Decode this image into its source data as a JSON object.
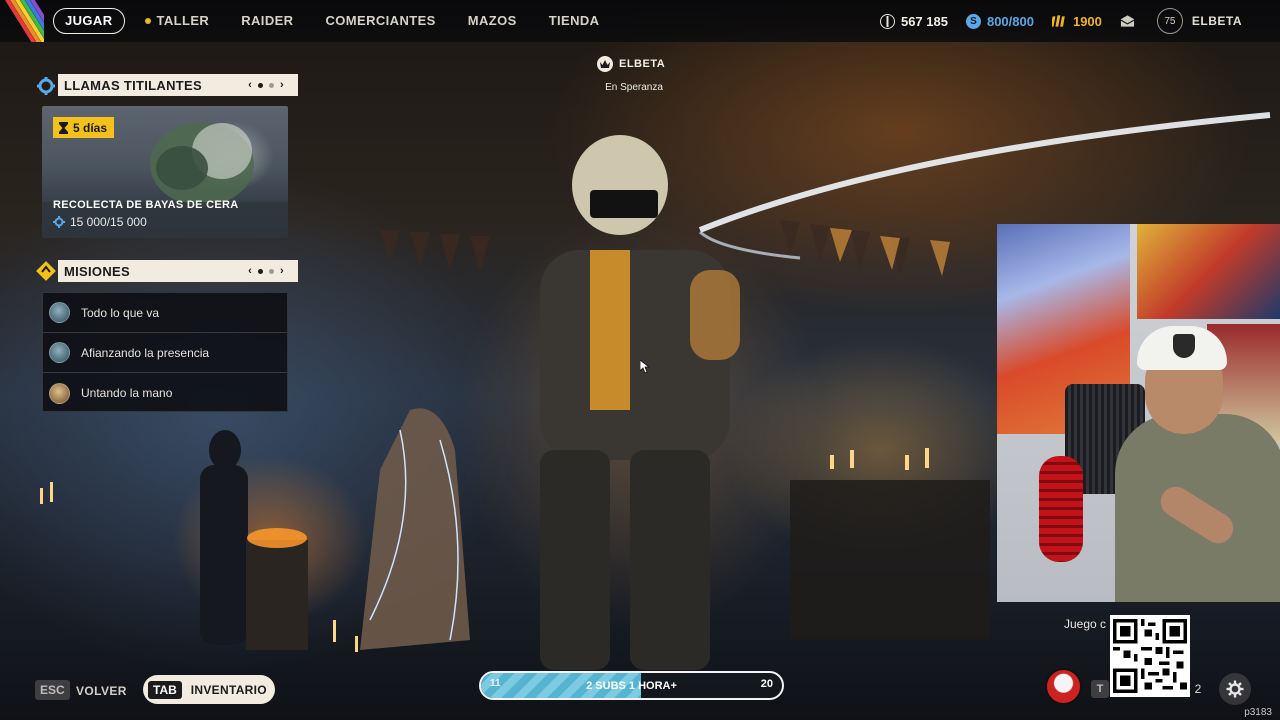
{
  "topbar": {
    "nav": [
      {
        "label": "JUGAR",
        "active": true
      },
      {
        "label": "TALLER",
        "active": false,
        "dot": true
      },
      {
        "label": "RAIDER",
        "active": false
      },
      {
        "label": "COMERCIANTES",
        "active": false
      },
      {
        "label": "MAZOS",
        "active": false
      },
      {
        "label": "TIENDA",
        "active": false
      }
    ],
    "currency_coins": "567 185",
    "currency_raider": "800/800",
    "currency_gold": "1900",
    "level": "75",
    "player": "ELBETA"
  },
  "event_panel": {
    "title": "LLAMAS TITILANTES",
    "timer": "5 días",
    "card_title": "RECOLECTA DE BAYAS DE CERA",
    "progress": "15 000/15 000"
  },
  "missions_panel": {
    "title": "MISIONES",
    "items": [
      {
        "label": "Todo lo que va"
      },
      {
        "label": "Afianzando la presencia"
      },
      {
        "label": "Untando la mano"
      }
    ]
  },
  "nametag": {
    "name": "ELBETA",
    "location": "En Speranza"
  },
  "webcam": {
    "caption": "Juego c"
  },
  "bottom": {
    "esc_key": "ESC",
    "back_label": "VOLVER",
    "tab_key": "TAB",
    "inventory_label": "INVENTARIO",
    "goal_low": "11",
    "goal_text": "2 SUBS 1 HORA+",
    "goal_high": "20",
    "goal_progress": 0.53,
    "t_key": "T",
    "count": "2",
    "build": "p3183"
  },
  "colors": {
    "accent_yellow": "#f3c21a",
    "raider_blue": "#5aa9e6",
    "gold": "#f0b429",
    "goal_blue": "#57b4d1"
  }
}
